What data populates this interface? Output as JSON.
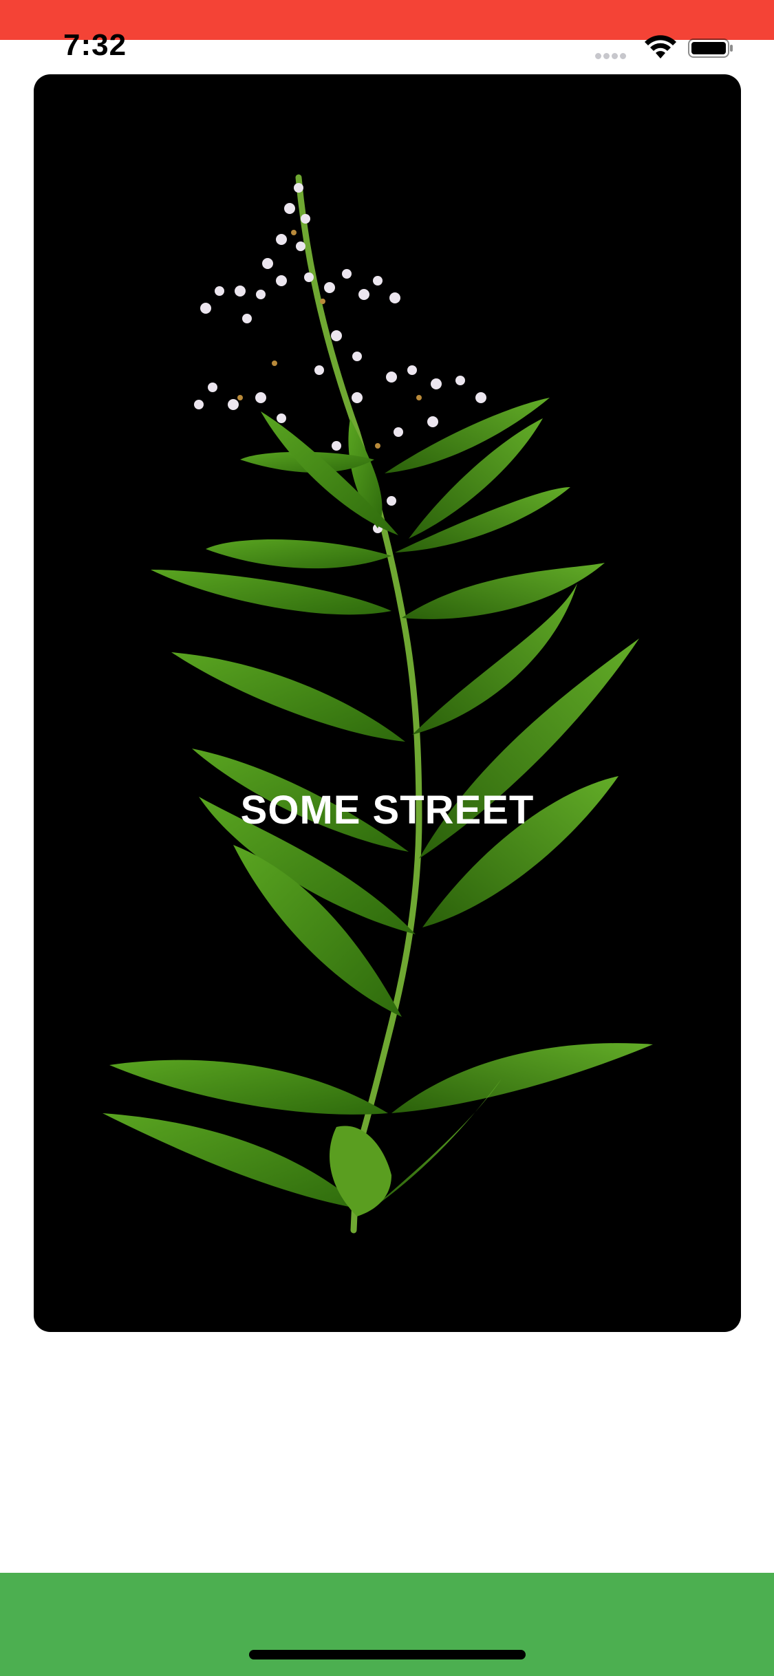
{
  "status_bar": {
    "time": "7:32",
    "icons": [
      "signal-icon",
      "wifi-icon",
      "battery-icon"
    ]
  },
  "colors": {
    "top_bar": "#f44336",
    "bottom_bar": "#4caf50",
    "card_background": "#000000",
    "card_title": "#ffffff"
  },
  "card": {
    "title": "SOME STREET",
    "image": "lemon-verbena-plant-photo"
  }
}
